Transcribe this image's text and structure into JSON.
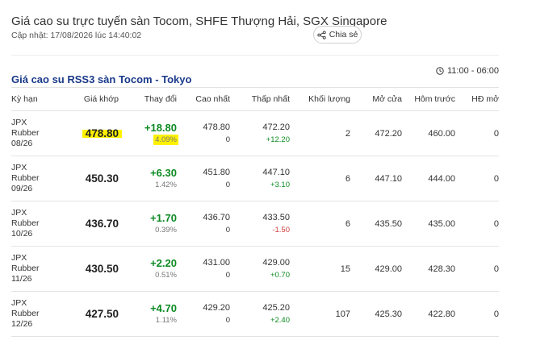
{
  "page": {
    "title": "Giá cao su trực tuyến sàn Tocom, SHFE Thượng Hải, SGX Singapore",
    "updated": "Cập nhật: 17/08/2026 lúc 14:40:02",
    "share_label": "Chia sẻ"
  },
  "section": {
    "title": "Giá cao su RSS3 sàn Tocom - Tokyo",
    "hours": "11:00 - 06:00"
  },
  "table": {
    "headers": {
      "name": "Kỳ hạn",
      "price": "Giá khớp",
      "change": "Thay đổi",
      "high": "Cao nhất",
      "low": "Thấp nhất",
      "volume": "Khối lượng",
      "open": "Mở cửa",
      "prev": "Hôm trước",
      "oi": "HĐ mở"
    },
    "rows": [
      {
        "name1": "JPX",
        "name2": "Rubber",
        "name3": "08/26",
        "price": "478.80",
        "change": "+18.80",
        "change_pct": "4.09%",
        "high": "478.80",
        "high_sub": "0",
        "low": "472.20",
        "low_sub": "+12.20",
        "low_sub_color": "green",
        "volume": "2",
        "open": "472.20",
        "prev": "460.00",
        "oi": "0",
        "highlighted": true
      },
      {
        "name1": "JPX",
        "name2": "Rubber",
        "name3": "09/26",
        "price": "450.30",
        "change": "+6.30",
        "change_pct": "1.42%",
        "high": "451.80",
        "high_sub": "0",
        "low": "447.10",
        "low_sub": "+3.10",
        "low_sub_color": "green",
        "volume": "6",
        "open": "447.10",
        "prev": "444.00",
        "oi": "0",
        "highlighted": false
      },
      {
        "name1": "JPX",
        "name2": "Rubber",
        "name3": "10/26",
        "price": "436.70",
        "change": "+1.70",
        "change_pct": "0.39%",
        "high": "436.70",
        "high_sub": "0",
        "low": "433.50",
        "low_sub": "-1.50",
        "low_sub_color": "red",
        "volume": "6",
        "open": "435.50",
        "prev": "435.00",
        "oi": "0",
        "highlighted": false
      },
      {
        "name1": "JPX",
        "name2": "Rubber",
        "name3": "11/26",
        "price": "430.50",
        "change": "+2.20",
        "change_pct": "0.51%",
        "high": "431.00",
        "high_sub": "0",
        "low": "429.00",
        "low_sub": "+0.70",
        "low_sub_color": "green",
        "volume": "15",
        "open": "429.00",
        "prev": "428.30",
        "oi": "0",
        "highlighted": false
      },
      {
        "name1": "JPX",
        "name2": "Rubber",
        "name3": "12/26",
        "price": "427.50",
        "change": "+4.70",
        "change_pct": "1.11%",
        "high": "429.20",
        "high_sub": "0",
        "low": "425.20",
        "low_sub": "+2.40",
        "low_sub_color": "green",
        "volume": "107",
        "open": "425.30",
        "prev": "422.80",
        "oi": "0",
        "highlighted": false
      }
    ]
  },
  "icons": {
    "share": "share-icon",
    "clock": "clock-icon"
  },
  "colors": {
    "section_title": "#1a3a8a",
    "up": "#0c8a22",
    "down": "#d04040",
    "highlight": "#fff200"
  }
}
